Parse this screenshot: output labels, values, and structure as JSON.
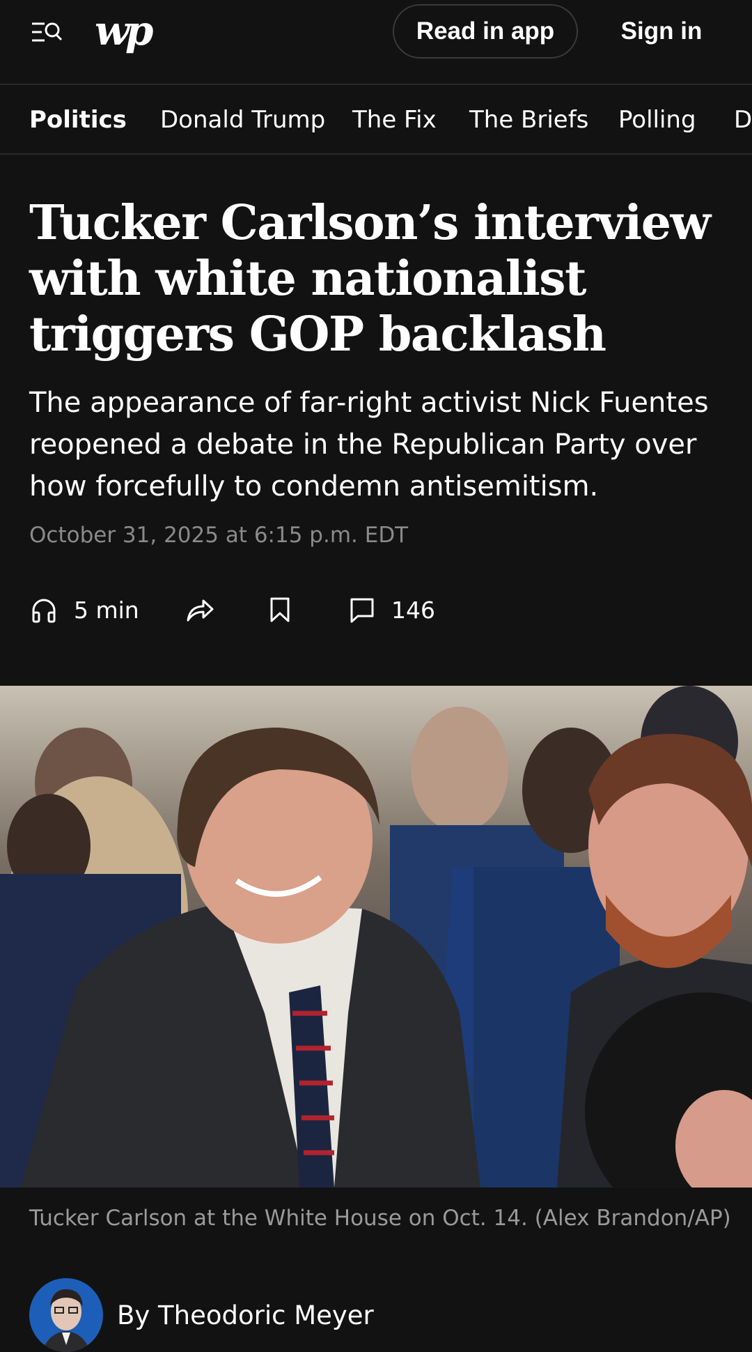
{
  "header": {
    "logo_text": "wp",
    "read_in_app_label": "Read in app",
    "sign_in_label": "Sign in",
    "menu_icon": "menu-search-icon"
  },
  "section_nav": {
    "tabs": [
      {
        "label": "Politics",
        "active": true
      },
      {
        "label": "Donald Trump",
        "active": false
      },
      {
        "label": "The Fix",
        "active": false
      },
      {
        "label": "The Briefs",
        "active": false
      },
      {
        "label": "Polling",
        "active": false
      },
      {
        "label": "Democracy",
        "active": false
      }
    ]
  },
  "article": {
    "headline": "Tucker Carlson’s interview with white nationalist triggers GOP backlash",
    "subheadline": "The appearance of far-right activist Nick Fuentes reopened a debate in the Republican Party over how forcefully to condemn antisemitism.",
    "timestamp": "October 31, 2025 at 6:15 p.m. EDT",
    "listen_label": "5 min",
    "comment_count": "146",
    "photo_caption": "Tucker Carlson at the White House on Oct. 14. (Alex Brandon/AP)",
    "byline": "By Theodoric Meyer"
  },
  "colors": {
    "background": "#121212",
    "text": "#ffffff",
    "muted_text": "#8a8a8a",
    "divider": "#2a2a2a",
    "avatar_bg": "#1d5fb8"
  }
}
